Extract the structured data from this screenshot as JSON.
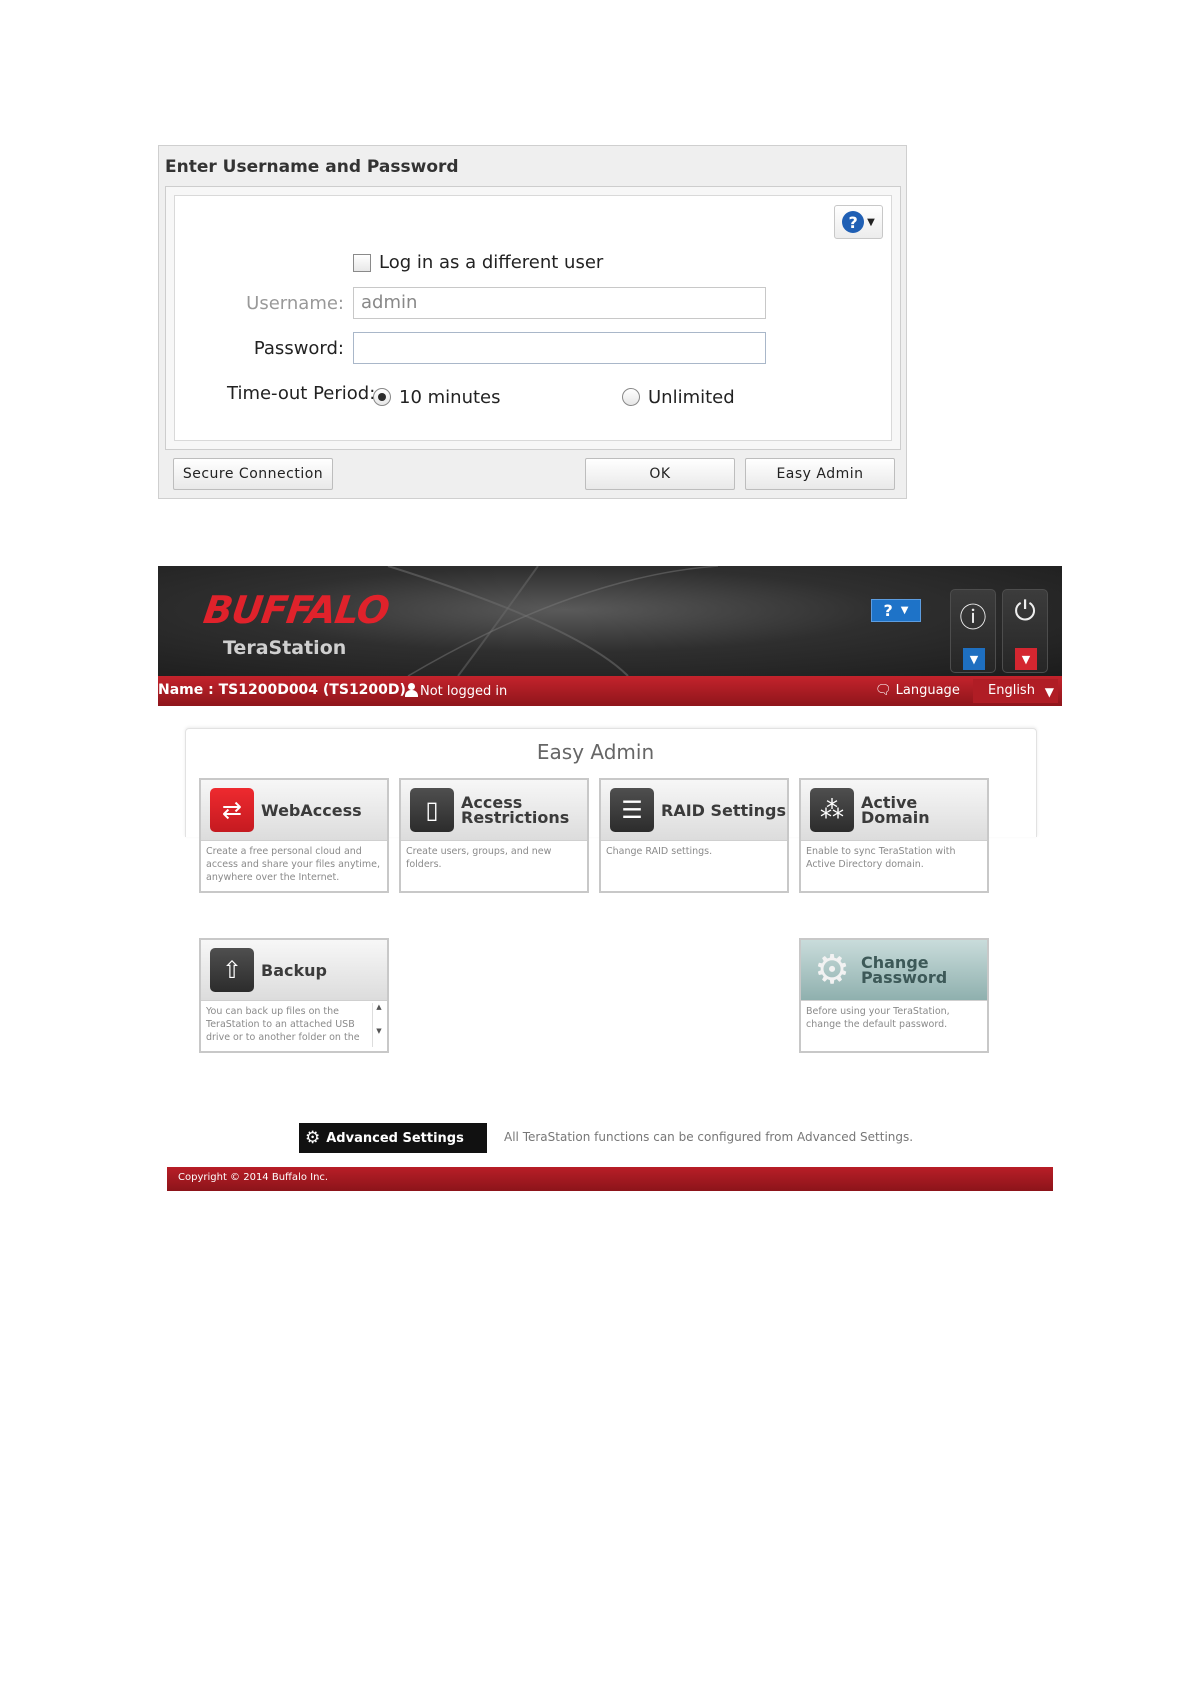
{
  "login_dialog": {
    "title": "Enter Username and Password",
    "help_icon": "?",
    "different_user_label": "Log in as a different user",
    "username_label": "Username:",
    "username_value": "admin",
    "password_label": "Password:",
    "password_value": "",
    "timeout_label": "Time-out Period:",
    "timeout_options": [
      "10 minutes",
      "Unlimited"
    ],
    "timeout_selected": "10 minutes",
    "buttons": {
      "secure": "Secure Connection",
      "ok": "OK",
      "easy_admin": "Easy Admin"
    }
  },
  "terastation": {
    "brand": "BUFFALO",
    "product": "TeraStation",
    "header_help": "?",
    "name_line": "Name : TS1200D004 (TS1200D)",
    "login_status": "Not logged in",
    "language_label": "Language",
    "language_value": "English",
    "easy_admin_title": "Easy Admin",
    "tiles": [
      {
        "title": "WebAccess",
        "desc": "Create a free personal cloud and access and share your files anytime, anywhere over the Internet.",
        "icon": "webaccess-icon"
      },
      {
        "title": "Access Restrictions",
        "desc": "Create users, groups, and new folders.",
        "icon": "access-restrictions-icon"
      },
      {
        "title": "RAID Settings",
        "desc": "Change RAID settings.",
        "icon": "raid-icon"
      },
      {
        "title": "Active Domain",
        "desc": "Enable to sync TeraStation with Active Directory domain.",
        "icon": "active-domain-icon"
      },
      {
        "title": "Backup",
        "desc": "You can back up files on the TeraStation to an attached USB drive or to another folder on the",
        "icon": "backup-icon"
      },
      {
        "title": "Change Password",
        "desc": "Before using your TeraStation, change the default password.",
        "icon": "gear-icon"
      }
    ],
    "advanced_button": "Advanced Settings",
    "advanced_note": "All TeraStation functions can be configured from Advanced Settings.",
    "copyright": "Copyright © 2014 Buffalo Inc.",
    "colors": {
      "brand_red": "#e0222b",
      "bar_red": "#b81e27",
      "help_blue": "#1e73c8"
    }
  }
}
